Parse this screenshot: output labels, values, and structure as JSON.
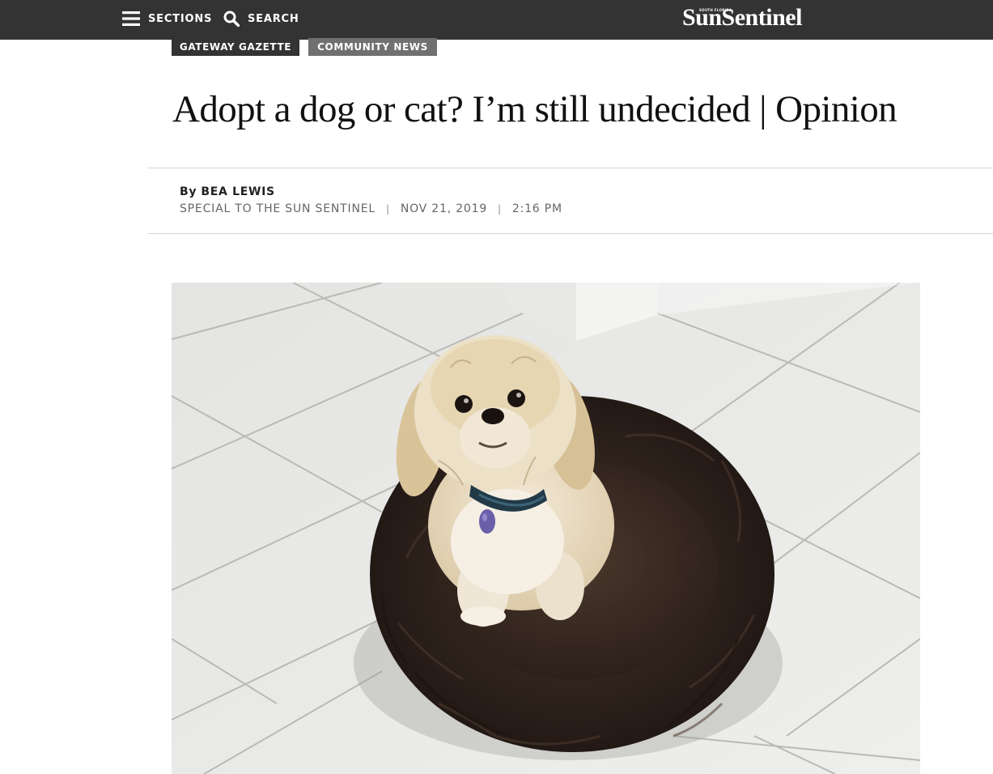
{
  "nav": {
    "sections_label": "SECTIONS",
    "search_label": "SEARCH",
    "logo_superscript": "SOUTH FLORIDA",
    "logo_text": "SunSentinel",
    "bar_color": "#333333"
  },
  "tags": {
    "primary": "GATEWAY GAZETTE",
    "secondary": "COMMUNITY NEWS"
  },
  "article": {
    "headline": "Adopt a dog or cat? I’m still undecided | Opinion",
    "byline_prefix": "By",
    "author": "BEA LEWIS",
    "affiliation": "SPECIAL TO THE SUN SENTINEL",
    "separator": "|",
    "date": "NOV 21, 2019",
    "time": "2:16 PM"
  },
  "icons": {
    "menu": "hamburger-menu-icon",
    "search": "magnifier-search-icon"
  }
}
